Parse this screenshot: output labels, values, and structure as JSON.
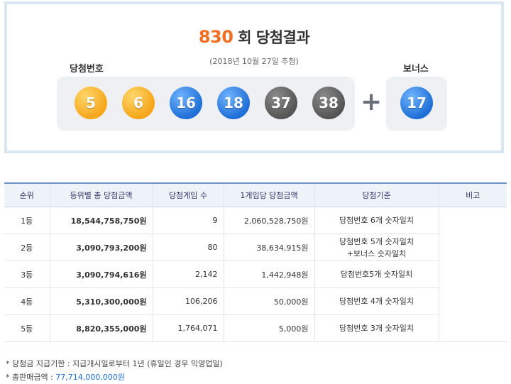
{
  "result": {
    "round_number": "830",
    "round_suffix": "회 당첨결과",
    "draw_date": "(2018년 10월 27일 추첨)",
    "winning_label": "당첨번호",
    "bonus_label": "보너스",
    "plus_sign": "+",
    "numbers": [
      "5",
      "6",
      "16",
      "18",
      "37",
      "38"
    ],
    "bonus_number": "17"
  },
  "table": {
    "headers": [
      "순위",
      "등위별 총 당첨금액",
      "당첨게임 수",
      "1게임당 당첨금액",
      "당첨기준",
      "비고"
    ],
    "rows": [
      {
        "rank": "1등",
        "total": "18,544,758,750원",
        "winners": "9",
        "per_game": "2,060,528,750원",
        "criteria_line1": "당첨번호 6개 숫자일치",
        "criteria_line2": ""
      },
      {
        "rank": "2등",
        "total": "3,090,793,200원",
        "winners": "80",
        "per_game": "38,634,915원",
        "criteria_line1": "당첨번호 5개 숫자일치",
        "criteria_line2": "+보너스 숫자일치"
      },
      {
        "rank": "3등",
        "total": "3,090,794,616원",
        "winners": "2,142",
        "per_game": "1,442,948원",
        "criteria_line1": "당첨번호5개 숫자일치",
        "criteria_line2": ""
      },
      {
        "rank": "4등",
        "total": "5,310,300,000원",
        "winners": "106,206",
        "per_game": "50,000원",
        "criteria_line1": "당첨번호 4개 숫자일치",
        "criteria_line2": ""
      },
      {
        "rank": "5등",
        "total": "8,820,355,000원",
        "winners": "1,764,071",
        "per_game": "5,000원",
        "criteria_line1": "당첨번호 3개 숫자일치",
        "criteria_line2": ""
      }
    ]
  },
  "notes": {
    "deadline": "* 당첨금 지급기한 : 지급개시일로부터 1년 (휴일인 경우 익영업일)",
    "sales_label": "* 총판매금액 : ",
    "sales_value": "77,714,000,000원"
  },
  "colors": {
    "accent_orange": "#f26f21",
    "ball_yellow": "#f5a61a",
    "ball_blue": "#1f6fd6",
    "ball_gray": "#555555"
  }
}
